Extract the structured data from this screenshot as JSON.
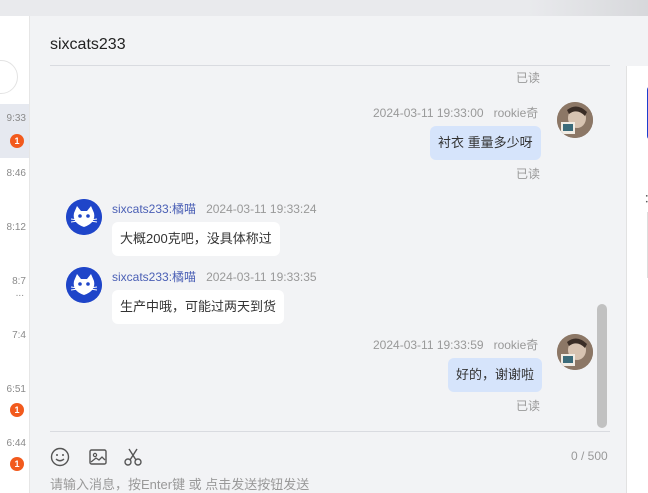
{
  "sidebar": {
    "items": [
      {
        "time": "9:33",
        "badge": "1",
        "active": true
      },
      {
        "time": "8:46"
      },
      {
        "time": "8:12"
      },
      {
        "time": "8:7",
        "dots": "..."
      },
      {
        "time": "7:4"
      },
      {
        "time": "6:51",
        "badge": "1"
      },
      {
        "time": "6:44",
        "badge": "1"
      }
    ]
  },
  "chat": {
    "title": "sixcats233",
    "messages": [
      {
        "direction": "out",
        "time": "2024-03-11 19:33:00",
        "sender": "rookie奇",
        "text": "衬衣 重量多少呀",
        "status": "已读"
      },
      {
        "direction": "in",
        "sender": "sixcats233:橘喵",
        "time": "2024-03-11 19:33:24",
        "text": "大概200克吧，没具体称过"
      },
      {
        "direction": "in",
        "sender": "sixcats233:橘喵",
        "time": "2024-03-11 19:33:35",
        "text": "生产中哦，可能过两天到货"
      },
      {
        "direction": "out",
        "time": "2024-03-11 19:33:59",
        "sender": "rookie奇",
        "text": "好的，谢谢啦",
        "status": "已读"
      }
    ],
    "top_status": "已读"
  },
  "input": {
    "placeholder": "请输入消息，按Enter键 或 点击发送按钮发送",
    "counter": "0 / 500",
    "tools": [
      "emoji-icon",
      "image-icon",
      "scissors-icon"
    ]
  },
  "right_panel": {
    "mark": "："
  },
  "colors": {
    "accent": "#1d3fcf",
    "badge": "#f25a1d",
    "out_bubble": "#d6e4fb"
  }
}
